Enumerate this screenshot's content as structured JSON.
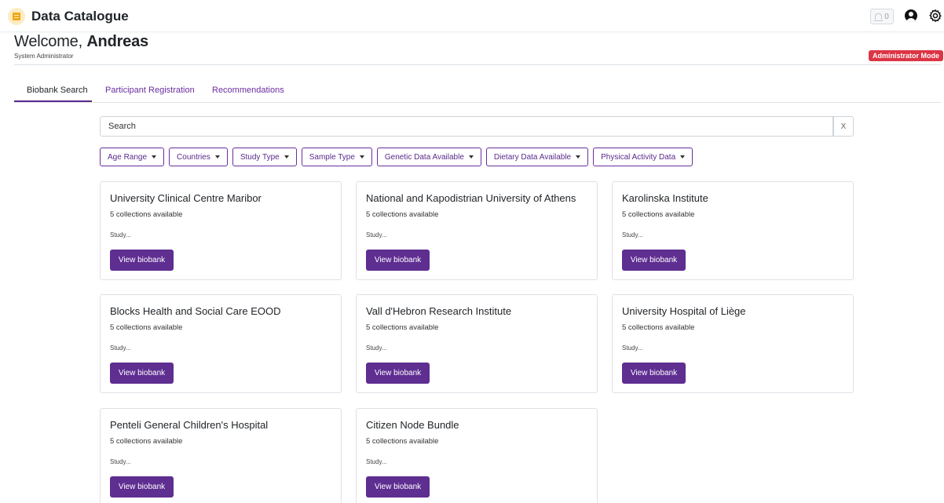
{
  "app": {
    "title": "Data Catalogue",
    "notification_count": "0"
  },
  "welcome": {
    "greeting": "Welcome,",
    "name": "Andreas",
    "role": "System Administrator",
    "badge": "Administrator Mode"
  },
  "tabs": [
    {
      "label": "Biobank Search",
      "active": true
    },
    {
      "label": "Participant Registration",
      "active": false
    },
    {
      "label": "Recommendations",
      "active": false
    }
  ],
  "search": {
    "placeholder": "Search",
    "clear_label": "X"
  },
  "filters": [
    "Age Range",
    "Countries",
    "Study Type",
    "Sample Type",
    "Genetic Data Available",
    "Dietary Data Available",
    "Physical Activity Data"
  ],
  "cards": [
    {
      "title": "University Clinical Centre Maribor",
      "count": "5 collections available",
      "desc": "Study...",
      "button": "View biobank"
    },
    {
      "title": "National and Kapodistrian University of Athens",
      "count": "5 collections available",
      "desc": "Study...",
      "button": "View biobank"
    },
    {
      "title": "Karolinska Institute",
      "count": "5 collections available",
      "desc": "Study...",
      "button": "View biobank"
    },
    {
      "title": "Blocks Health and Social Care EOOD",
      "count": "5 collections available",
      "desc": "Study...",
      "button": "View biobank"
    },
    {
      "title": "Vall d'Hebron Research Institute",
      "count": "5 collections available",
      "desc": "Study...",
      "button": "View biobank"
    },
    {
      "title": "University Hospital of Liège",
      "count": "5 collections available",
      "desc": "Study...",
      "button": "View biobank"
    },
    {
      "title": "Penteli General Children's Hospital",
      "count": "5 collections available",
      "desc": "Study...",
      "button": "View biobank"
    },
    {
      "title": "Citizen Node Bundle",
      "count": "5 collections available",
      "desc": "Study...",
      "button": "View biobank"
    }
  ],
  "icons": {
    "logo": "catalogue-logo-icon",
    "notifications": "bell-icon",
    "user": "user-circle-icon",
    "settings": "gear-icon",
    "dropdown": "caret-down-icon"
  },
  "colors": {
    "accent": "#5e2e91",
    "badge": "#dc3545",
    "logo": "#f0a818"
  }
}
